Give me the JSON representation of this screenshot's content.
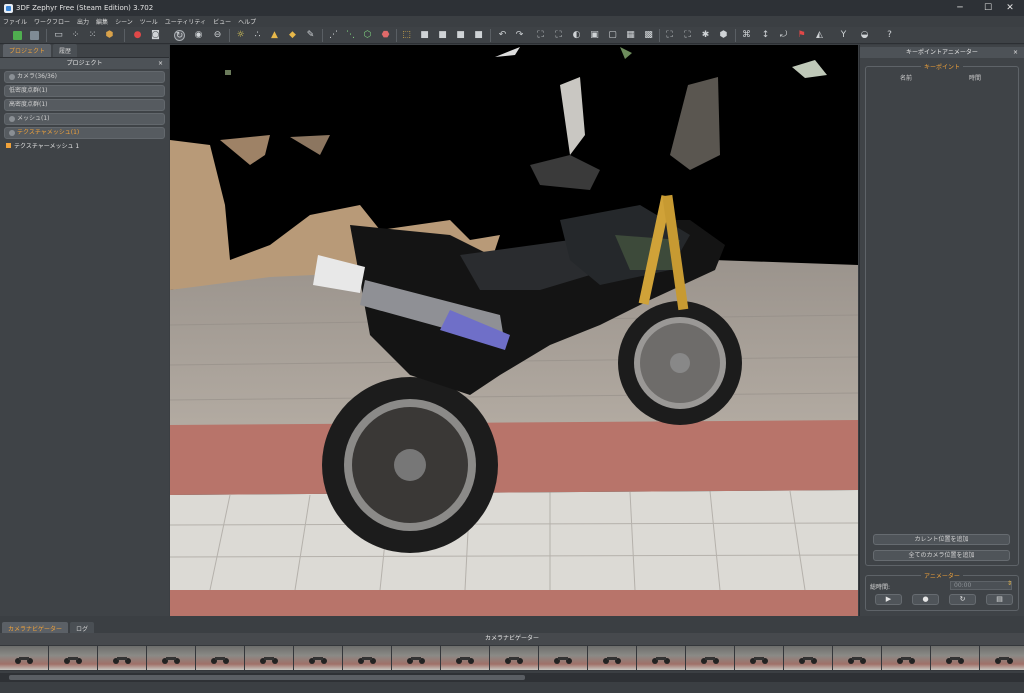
{
  "window": {
    "title": "3DF Zephyr Free (Steam Edition) 3.702",
    "minimize": "─",
    "maximize": "☐",
    "close": "✕"
  },
  "menu": [
    "ファイル",
    "ワークフロー",
    "出力",
    "編集",
    "シーン",
    "ツール",
    "ユーティリティ",
    "ビュー",
    "ヘルプ"
  ],
  "left_panel": {
    "tabs": [
      "プロジェクト",
      "履歴"
    ],
    "title": "プロジェクト",
    "close": "×",
    "groups": [
      {
        "label": "カメラ(36/36)",
        "highlight": false
      },
      {
        "label": "低密度点群(1)",
        "highlight": false
      },
      {
        "label": "高密度点群(1)",
        "highlight": false
      },
      {
        "label": "メッシュ(1)",
        "highlight": false
      },
      {
        "label": "テクスチャメッシュ(1)",
        "highlight": true
      }
    ],
    "leaf": "テクスチャーメッシュ 1"
  },
  "right_panel": {
    "title": "キーポイントアニメーター",
    "close": "×",
    "keypoint_legend": "キーポイント",
    "col_name": "名前",
    "col_time": "時間",
    "add_current": "カレント位置を追加",
    "add_all_cameras": "全てのカメラ位置を追加",
    "animator_legend": "アニメーター",
    "duration_label": "総時間:",
    "duration_value": "00:00",
    "btn_play": "▶",
    "btn_record": "●",
    "btn_loop": "↻",
    "btn_save": "▤"
  },
  "bottom": {
    "tabs": [
      "カメラナビゲーター",
      "ログ"
    ],
    "navigator_title": "カメラナビゲーター",
    "thumbnail_count": 21
  },
  "colors": {
    "accent": "#f0a23a",
    "panel": "#3f4347",
    "viewport": "#000000"
  }
}
